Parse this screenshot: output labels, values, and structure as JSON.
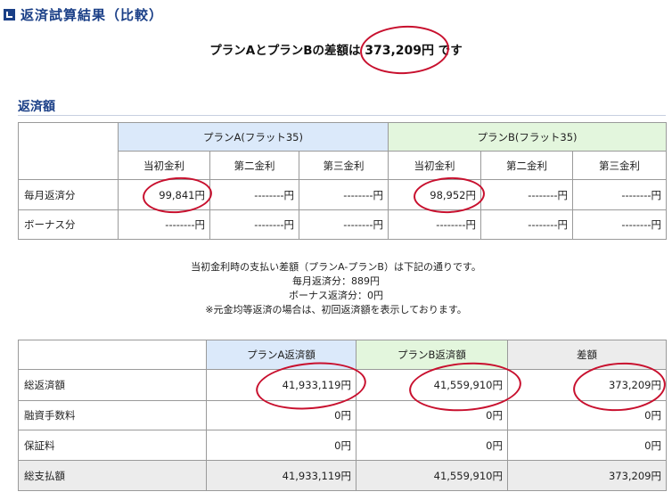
{
  "header": {
    "title": "返済試算結果（比較）"
  },
  "summary": {
    "prefix": "プランAとプランBの差額は",
    "amount": "373,209円",
    "suffix": "です"
  },
  "section": {
    "title": "返済額"
  },
  "monthly_table": {
    "plan_a": "プランA(フラット35)",
    "plan_b": "プランB(フラット35)",
    "sub_headers": [
      "当初金利",
      "第二金利",
      "第三金利",
      "当初金利",
      "第二金利",
      "第三金利"
    ],
    "rows": [
      {
        "label": "毎月返済分",
        "values": [
          "99,841円",
          "--------円",
          "--------円",
          "98,952円",
          "--------円",
          "--------円"
        ]
      },
      {
        "label": "ボーナス分",
        "values": [
          "--------円",
          "--------円",
          "--------円",
          "--------円",
          "--------円",
          "--------円"
        ]
      }
    ]
  },
  "notes": [
    "当初金利時の支払い差額（プランA-プランB）は下記の通りです。",
    "毎月返済分：889円",
    "ボーナス返済分：0円",
    "※元金均等返済の場合は、初回返済額を表示しております。"
  ],
  "totals_table": {
    "headers": [
      "プランA返済額",
      "プランB返済額",
      "差額"
    ],
    "rows": [
      {
        "label": "総返済額",
        "values": [
          "41,933,119円",
          "41,559,910円",
          "373,209円"
        ]
      },
      {
        "label": "融資手数料",
        "values": [
          "0円",
          "0円",
          "0円"
        ]
      },
      {
        "label": "保証料",
        "values": [
          "0円",
          "0円",
          "0円"
        ]
      },
      {
        "label": "総支払額",
        "values": [
          "41,933,119円",
          "41,559,910円",
          "373,209円"
        ]
      }
    ]
  },
  "colors": {
    "heading": "#1a3f87",
    "plan_a_bg": "#dbe9fa",
    "plan_b_bg": "#e3f6dd",
    "diff_bg": "#ececec",
    "annotation": "#c8102e"
  }
}
